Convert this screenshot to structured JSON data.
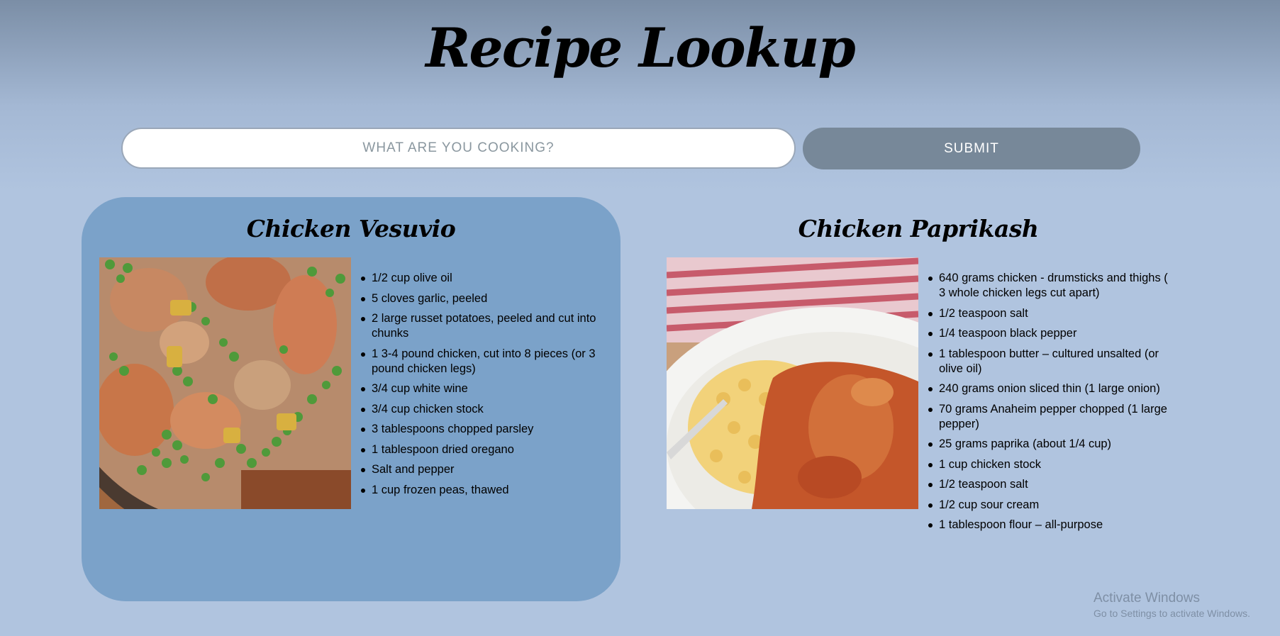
{
  "header": {
    "title": "Recipe Lookup"
  },
  "search": {
    "placeholder": "WHAT ARE YOU COOKING?",
    "value": "",
    "submit_label": "SUBMIT"
  },
  "recipes": [
    {
      "title": "Chicken Vesuvio",
      "image_alt": "Chicken Vesuvio",
      "ingredients": [
        "1/2 cup olive oil",
        "5 cloves garlic, peeled",
        "2 large russet potatoes, peeled and cut into chunks",
        "1 3-4 pound chicken, cut into 8 pieces (or 3 pound chicken legs)",
        "3/4 cup white wine",
        "3/4 cup chicken stock",
        "3 tablespoons chopped parsley",
        "1 tablespoon dried oregano",
        "Salt and pepper",
        "1 cup frozen peas, thawed"
      ]
    },
    {
      "title": "Chicken Paprikash",
      "image_alt": "Chicken Paprikash",
      "ingredients": [
        "640 grams chicken - drumsticks and thighs ( 3 whole chicken legs cut apart)",
        "1/2 teaspoon salt",
        "1/4 teaspoon black pepper",
        "1 tablespoon butter – cultured unsalted (or olive oil)",
        "240 grams onion sliced thin (1 large onion)",
        "70 grams Anaheim pepper chopped (1 large pepper)",
        "25 grams paprika (about 1/4 cup)",
        "1 cup chicken stock",
        "1/2 teaspoon salt",
        "1/2 cup sour cream",
        "1 tablespoon flour – all-purpose"
      ]
    }
  ],
  "watermark": {
    "title": "Activate Windows",
    "subtitle": "Go to Settings to activate Windows."
  },
  "colors": {
    "card_bg": "#7ba2c9",
    "page_bg": "#b0c4df",
    "submit_bg": "#778899"
  }
}
